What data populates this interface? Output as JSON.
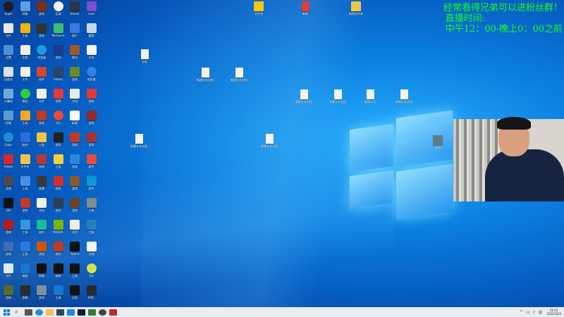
{
  "overlay": {
    "line1": "经常看得兄弟可以进粉丝群！",
    "line2": "直播时间:",
    "line3": "中午12：00-晚上0：00之前"
  },
  "desktop_icons": [
    {
      "label": "Apple",
      "color": "#1d1d1d",
      "round": true
    },
    {
      "label": "网络",
      "color": "#5aa0e6"
    },
    {
      "label": "游戏",
      "color": "#7a2e1c"
    },
    {
      "label": "足球",
      "color": "#f2f2f2",
      "round": true
    },
    {
      "label": "Steam",
      "color": "#2d3442"
    },
    {
      "label": "mod",
      "color": "#7c4dcd"
    },
    {
      "label": "文件",
      "color": "#e8e8e8"
    },
    {
      "label": "工具",
      "color": "#f5b301"
    },
    {
      "label": "游戏",
      "color": "#333333"
    },
    {
      "label": "WeGame",
      "color": "#39c06d"
    },
    {
      "label": "图片",
      "color": "#3b7ad9"
    },
    {
      "label": "截图",
      "color": "#c9d6e8"
    },
    {
      "label": "设置",
      "color": "#4a90d9"
    },
    {
      "label": "文档",
      "color": "#eeeeee"
    },
    {
      "label": "浏览器",
      "color": "#1e9be0",
      "round": true
    },
    {
      "label": "游戏",
      "color": "#1e3a8a"
    },
    {
      "label": "素材",
      "color": "#a35a2a"
    },
    {
      "label": "文档",
      "color": "#f4f4f4"
    },
    {
      "label": "回收站",
      "color": "#d7e3f0"
    },
    {
      "label": "文件",
      "color": "#f0f0f0"
    },
    {
      "label": "软件",
      "color": "#d6452f"
    },
    {
      "label": "Steam",
      "color": "#2a475e"
    },
    {
      "label": "游戏",
      "color": "#6b8e23"
    },
    {
      "label": "浏览器",
      "color": "#2f80ed",
      "round": true
    },
    {
      "label": "计算机",
      "color": "#6fa8dc"
    },
    {
      "label": "微信",
      "color": "#2ecc40",
      "round": true
    },
    {
      "label": "文件",
      "color": "#eeeeee"
    },
    {
      "label": "视频",
      "color": "#e23b3b"
    },
    {
      "label": "文档",
      "color": "#eaeaea"
    },
    {
      "label": "游戏",
      "color": "#e53935"
    },
    {
      "label": "控制",
      "color": "#5b9bd5"
    },
    {
      "label": "工具",
      "color": "#f5a623"
    },
    {
      "label": "游戏",
      "color": "#c0392b"
    },
    {
      "label": "QQ",
      "color": "#e74c3c",
      "round": true
    },
    {
      "label": "新建",
      "color": "#f6f6f6"
    },
    {
      "label": "游戏",
      "color": "#8e2c2c"
    },
    {
      "label": "Edge",
      "color": "#1a8fd6",
      "round": true
    },
    {
      "label": "软件",
      "color": "#2d6cdf"
    },
    {
      "label": "工具",
      "color": "#f6c445"
    },
    {
      "label": "游戏",
      "color": "#222222"
    },
    {
      "label": "游戏",
      "color": "#c0392b"
    },
    {
      "label": "游戏",
      "color": "#a83232"
    },
    {
      "label": "Adobe",
      "color": "#d42a2a"
    },
    {
      "label": "文件夹",
      "color": "#f2c14e"
    },
    {
      "label": "游戏",
      "color": "#b33939"
    },
    {
      "label": "工具",
      "color": "#f4d03f"
    },
    {
      "label": "游戏",
      "color": "#2e86de"
    },
    {
      "label": "软件",
      "color": "#e74c3c"
    },
    {
      "label": "游戏",
      "color": "#4a4a4a"
    },
    {
      "label": "工具",
      "color": "#4a90e2"
    },
    {
      "label": "直播",
      "color": "#3a3a3a"
    },
    {
      "label": "视频",
      "color": "#d32f2f"
    },
    {
      "label": "游戏",
      "color": "#8b5a2b"
    },
    {
      "label": "软件",
      "color": "#0d98d6"
    },
    {
      "label": "QQ",
      "color": "#111111"
    },
    {
      "label": "游戏",
      "color": "#c0392b"
    },
    {
      "label": "文档",
      "color": "#f0f0f0"
    },
    {
      "label": "游戏",
      "color": "#2c3e50"
    },
    {
      "label": "游戏",
      "color": "#6b4226"
    },
    {
      "label": "工具",
      "color": "#7f8c8d"
    },
    {
      "label": "游戏",
      "color": "#b71c1c"
    },
    {
      "label": "工具",
      "color": "#3498db"
    },
    {
      "label": "软件",
      "color": "#1abc9c"
    },
    {
      "label": "NVIDIA",
      "color": "#76b900"
    },
    {
      "label": "文件",
      "color": "#eeeeee"
    },
    {
      "label": "工具",
      "color": "#2980b9"
    },
    {
      "label": "游戏",
      "color": "#3d6cb9"
    },
    {
      "label": "工具",
      "color": "#2b78e4"
    },
    {
      "label": "游戏",
      "color": "#d35400"
    },
    {
      "label": "游戏",
      "color": "#c0392b"
    },
    {
      "label": "Twitch",
      "color": "#111111"
    },
    {
      "label": "文档",
      "color": "#f2f2f2"
    },
    {
      "label": "文件",
      "color": "#dbe9f7"
    },
    {
      "label": "搜索",
      "color": "#1976d2"
    },
    {
      "label": "剪辑",
      "color": "#111111"
    },
    {
      "label": "剪映",
      "color": "#111111"
    },
    {
      "label": "工具",
      "color": "#111111"
    },
    {
      "label": "QQ",
      "color": "#d4e157",
      "round": true
    },
    {
      "label": "游戏",
      "color": "#556b2f"
    },
    {
      "label": "剪辑",
      "color": "#2c2c2c"
    },
    {
      "label": "游戏",
      "color": "#7f8fa6"
    },
    {
      "label": "工具",
      "color": "#1976d2"
    },
    {
      "label": "抖音",
      "color": "#111111"
    },
    {
      "label": "EPIC",
      "color": "#2a2a2a"
    }
  ],
  "desktop_files": [
    {
      "label": "文件夹",
      "type": "folder-yellow"
    },
    {
      "label": "新建",
      "type": "doc-red"
    },
    {
      "label": "新建文件夹",
      "type": "folder"
    },
    {
      "label": "新建文本文档",
      "type": "doc"
    },
    {
      "label": "新建文本文档",
      "type": "doc"
    },
    {
      "label": "新建文本文档",
      "type": "doc"
    },
    {
      "label": "新建文本文档",
      "type": "doc"
    },
    {
      "label": "新建文本",
      "type": "doc"
    },
    {
      "label": "新建文本文档",
      "type": "doc"
    },
    {
      "label": "新建文本文档",
      "type": "doc"
    },
    {
      "label": "新建文本文档",
      "type": "doc"
    },
    {
      "label": "文档",
      "type": "doc"
    },
    {
      "label": "游戏",
      "type": "app"
    }
  ],
  "taskbar": {
    "start_icon": "windows-start-icon",
    "clock_time": "21:01",
    "clock_date": "2022/10/3"
  }
}
